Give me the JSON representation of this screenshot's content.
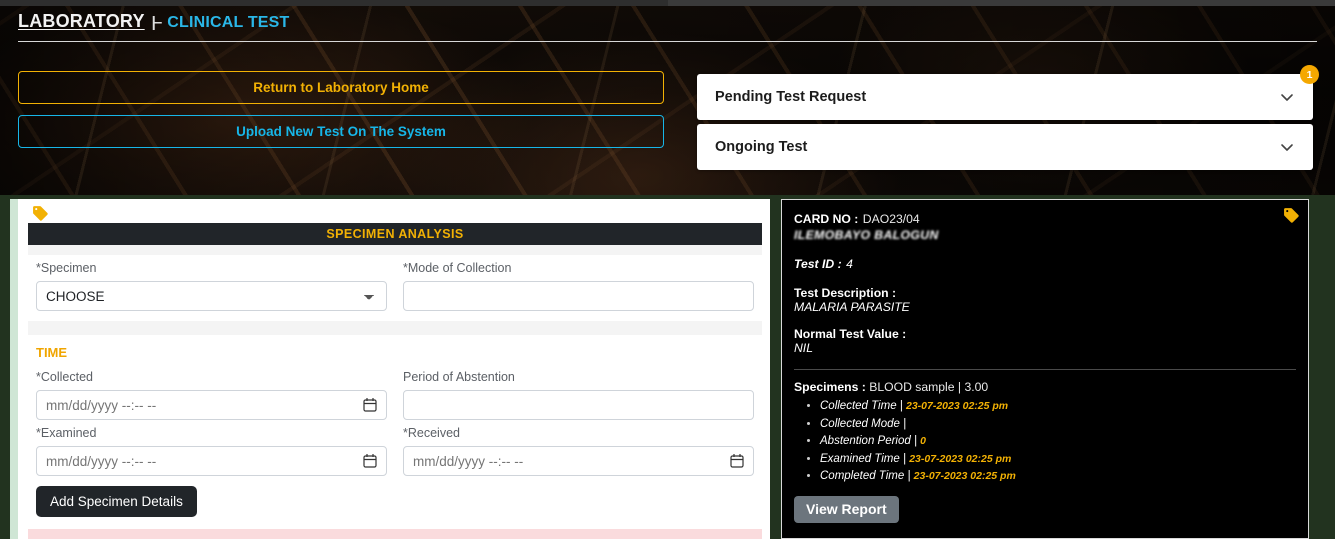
{
  "breadcrumb": {
    "root": "LABORATORY",
    "separator": "|–",
    "current": "CLINICAL TEST"
  },
  "hero": {
    "buttons": [
      {
        "label": "Return to Laboratory Home",
        "color": "#f2b104",
        "icon": "home-button"
      },
      {
        "label": "Upload New Test On The System",
        "color": "#17b6e8",
        "icon": "upload-button"
      }
    ]
  },
  "accordions": [
    {
      "label": "Pending Test Request",
      "badge": "1",
      "icon": "chevron-down-icon"
    },
    {
      "label": "Ongoing Test",
      "badge": "",
      "icon": "chevron-down-icon"
    }
  ],
  "form": {
    "tag_icon": "tag-icon",
    "title": "SPECIMEN ANALYSIS",
    "specimen_label": "*Specimen",
    "specimen_value": "CHOOSE",
    "specimen_options": [
      "CHOOSE"
    ],
    "mode_label": "*Mode of Collection",
    "mode_value": "",
    "mode_placeholder": "",
    "time_heading": "TIME",
    "collected_label": "*Collected",
    "collected_value": "",
    "collected_placeholder": "mm/dd/yyyy --:-- --",
    "abstention_label": "Period of Abstention",
    "abstention_value": "",
    "abstention_placeholder": "",
    "examined_label": "*Examined",
    "examined_value": "",
    "examined_placeholder": "mm/dd/yyyy --:-- --",
    "received_label": "*Received",
    "received_value": "",
    "received_placeholder": "mm/dd/yyyy --:-- --",
    "submit_label": "Add Specimen Details"
  },
  "test_card": {
    "tag_icon": "tag-icon",
    "card_no_label": "CARD NO :",
    "card_no_value": "DAO23/04",
    "patient_name": "ILEMOBAYO BALOGUN",
    "test_id_label": "Test ID :",
    "test_id_value": "4",
    "description_label": "Test Description :",
    "description_value": "MALARIA PARASITE",
    "normal_value_label": "Normal Test Value :",
    "normal_value": "NIL",
    "specimens_label": "Specimens :",
    "specimens_value": "BLOOD sample | 3.00",
    "details": [
      {
        "label": "Collected Time |",
        "value": "23-07-2023 02:25 pm"
      },
      {
        "label": "Collected Mode |",
        "value": ""
      },
      {
        "label": "Abstention Period |",
        "value": "0"
      },
      {
        "label": "Examined Time |",
        "value": "23-07-2023 02:25 pm"
      },
      {
        "label": "Completed Time |",
        "value": "23-07-2023 02:25 pm"
      }
    ],
    "view_report_label": "View Report"
  },
  "colors": {
    "amber": "#f2b104",
    "cyan": "#17b6e8",
    "badge": "#f5a800",
    "page_bg": "#22331f",
    "panel_dark": "#212529",
    "card_accent": "#cfe6d5"
  }
}
